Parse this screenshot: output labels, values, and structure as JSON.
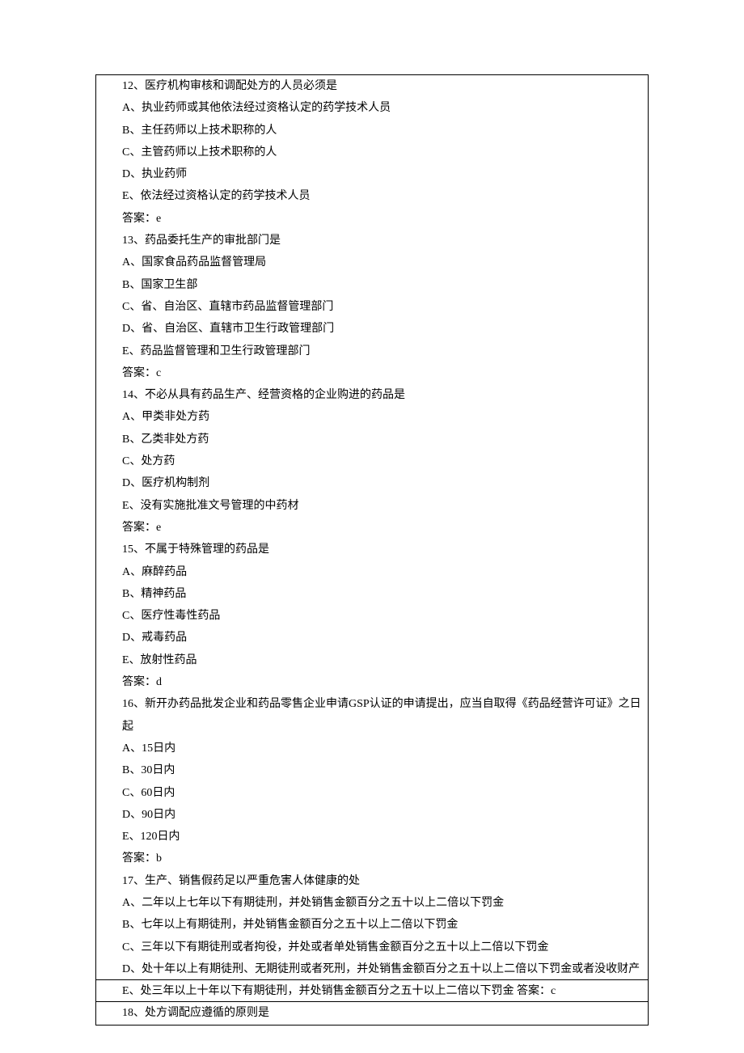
{
  "q12": {
    "stem": "12、医疗机构审核和调配处方的人员必须是",
    "A": "A、执业药师或其他依法经过资格认定的药学技术人员",
    "B": "B、主任药师以上技术职称的人",
    "C": "C、主管药师以上技术职称的人",
    "D": "D、执业药师",
    "E": "E、依法经过资格认定的药学技术人员",
    "ans": "答案：e"
  },
  "q13": {
    "stem": "13、药品委托生产的审批部门是",
    "A": "A、国家食品药品监督管理局",
    "B": "B、国家卫生部",
    "C": "C、省、自治区、直辖市药品监督管理部门",
    "D": "D、省、自治区、直辖市卫生行政管理部门",
    "E": "E、药品监督管理和卫生行政管理部门",
    "ans": "答案：c"
  },
  "q14": {
    "stem": "14、不必从具有药品生产、经营资格的企业购进的药品是",
    "A": "A、甲类非处方药",
    "B": "B、乙类非处方药",
    "C": "C、处方药",
    "D": "D、医疗机构制剂",
    "E": "E、没有实施批准文号管理的中药材",
    "ans": "答案：e"
  },
  "q15": {
    "stem": "15、不属于特殊管理的药品是",
    "A": "A、麻醉药品",
    "B": "B、精神药品",
    "C": "C、医疗性毒性药品",
    "D": "D、戒毒药品",
    "E": "E、放射性药品",
    "ans": "答案：d"
  },
  "q16": {
    "stem": "16、新开办药品批发企业和药品零售企业申请GSP认证的申请提出，应当自取得《药品经营许可证》之日起",
    "A": "A、15日内",
    "B": "B、30日内",
    "C": "C、60日内",
    "D": "D、90日内",
    "E": "E、120日内",
    "ans": "答案：b"
  },
  "q17": {
    "stem": "17、生产、销售假药足以严重危害人体健康的处",
    "A": "A、二年以上七年以下有期徒刑，并处销售金额百分之五十以上二倍以下罚金",
    "B": "B、七年以上有期徒刑，并处销售金额百分之五十以上二倍以下罚金",
    "C": "C、三年以下有期徒刑或者拘役，并处或者单处销售金额百分之五十以上二倍以下罚金",
    "D": "D、处十年以上有期徒刑、无期徒刑或者死刑，并处销售金额百分之五十以上二倍以下罚金或者没收财产",
    "E": "E、处三年以上十年以下有期徒刑，并处销售金额百分之五十以上二倍以下罚金 答案：c"
  },
  "q18": {
    "stem": "18、处方调配应遵循的原则是"
  }
}
